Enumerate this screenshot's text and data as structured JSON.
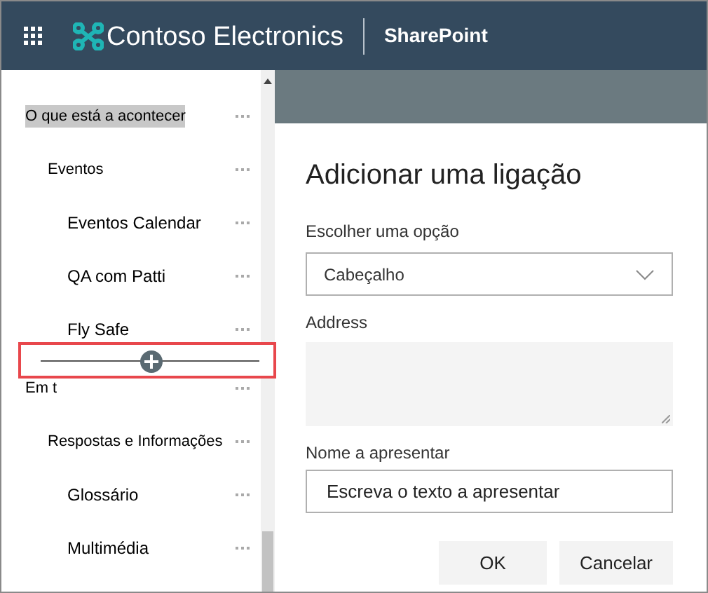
{
  "header": {
    "brand": "Contoso Electronics",
    "app": "SharePoint"
  },
  "nav": [
    {
      "label": "O que está a acontecer",
      "selected": true,
      "children": [
        {
          "label": "Eventos",
          "selected": false,
          "children": [
            {
              "label": "Eventos Calendar",
              "selected": false
            },
            {
              "label": "QA com Patti",
              "selected": false
            },
            {
              "label": "Fly Safe",
              "selected": false,
              "insert_line_after": true
            }
          ]
        }
      ]
    },
    {
      "label": "Em t",
      "selected": false,
      "children": [
        {
          "label": "Respostas e Informações",
          "selected": false,
          "children": [
            {
              "label": "Glossário",
              "selected": false
            },
            {
              "label": "Multimédia",
              "selected": false
            }
          ]
        }
      ]
    }
  ],
  "dialog": {
    "title": "Adicionar uma ligação",
    "option_label": "Escolher uma opção",
    "option_value": "Cabeçalho",
    "address_label": "Address",
    "name_label": "Nome a apresentar",
    "name_value": "Escreva o texto a apresentar",
    "buttons": [
      "OK",
      "Cancelar"
    ]
  }
}
